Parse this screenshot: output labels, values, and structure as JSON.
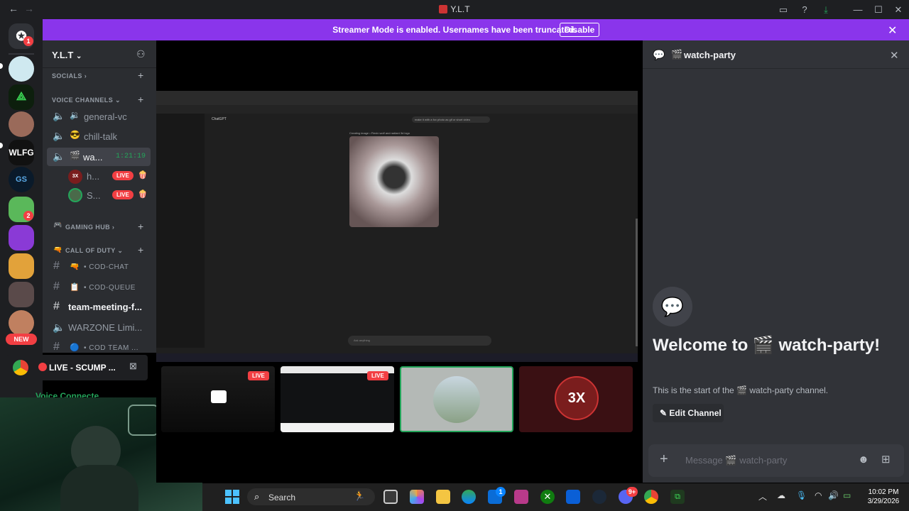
{
  "titlebar": {
    "title": "Y.L.T"
  },
  "banner": {
    "message": "Streamer Mode is enabled. Usernames have been truncated.",
    "button": "Disable"
  },
  "rail": {
    "dm_badge": "1",
    "server_badge": "2",
    "new_label": "NEW"
  },
  "sidebar": {
    "server_name": "Y.L.T",
    "categories": {
      "socials": "SOCIALS",
      "voice": "VOICE CHANNELS",
      "gaming": "GAMING HUB",
      "cod": "CALL OF DUTY"
    },
    "voice_channels": [
      {
        "name": "general-vc"
      },
      {
        "name": "chill-talk"
      },
      {
        "name": "wa...",
        "timer": "1:21:19"
      }
    ],
    "voice_users": [
      {
        "name": "h...",
        "live": "LIVE"
      },
      {
        "name": "S...",
        "live": "LIVE"
      }
    ],
    "text_channels": [
      {
        "name": "COD-CHAT"
      },
      {
        "name": "COD-QUEUE"
      },
      {
        "name": "team-meeting-f..."
      },
      {
        "name": "WARZONE Limi..."
      },
      {
        "name": "COD TEAM ..."
      }
    ]
  },
  "overlay": {
    "chrome_tab": "LIVE - SCUMP ...",
    "voice_connected": "Voice Connecte"
  },
  "stream": {
    "tiles": [
      {
        "live": "LIVE"
      },
      {
        "live": "LIVE"
      },
      {
        "avatar_text": "3X"
      }
    ],
    "screen": {
      "app": "ChatGPT",
      "status": "Creating image • Flexin wolf and radiant 3d logo",
      "prompt_hint": "make it with a fox photo as gif or short video",
      "input_placeholder": "Ask anything"
    }
  },
  "panel": {
    "channel": "watch-party",
    "welcome_prefix": "Welcome to",
    "welcome_channel": "watch-party!",
    "start_prefix": "This is the start of the",
    "start_channel": "watch-party channel.",
    "edit_button": "Edit Channel",
    "message_placeholder": "Message",
    "message_channel": "watch-party"
  },
  "taskbar": {
    "search": "Search",
    "time": "10:02 PM",
    "date": "3/29/2026",
    "store_badge": "1",
    "discord_badge": "9+"
  },
  "colors": {
    "brand": "#8a35eb",
    "live": "#f23f43",
    "accent": "#5865f2"
  }
}
